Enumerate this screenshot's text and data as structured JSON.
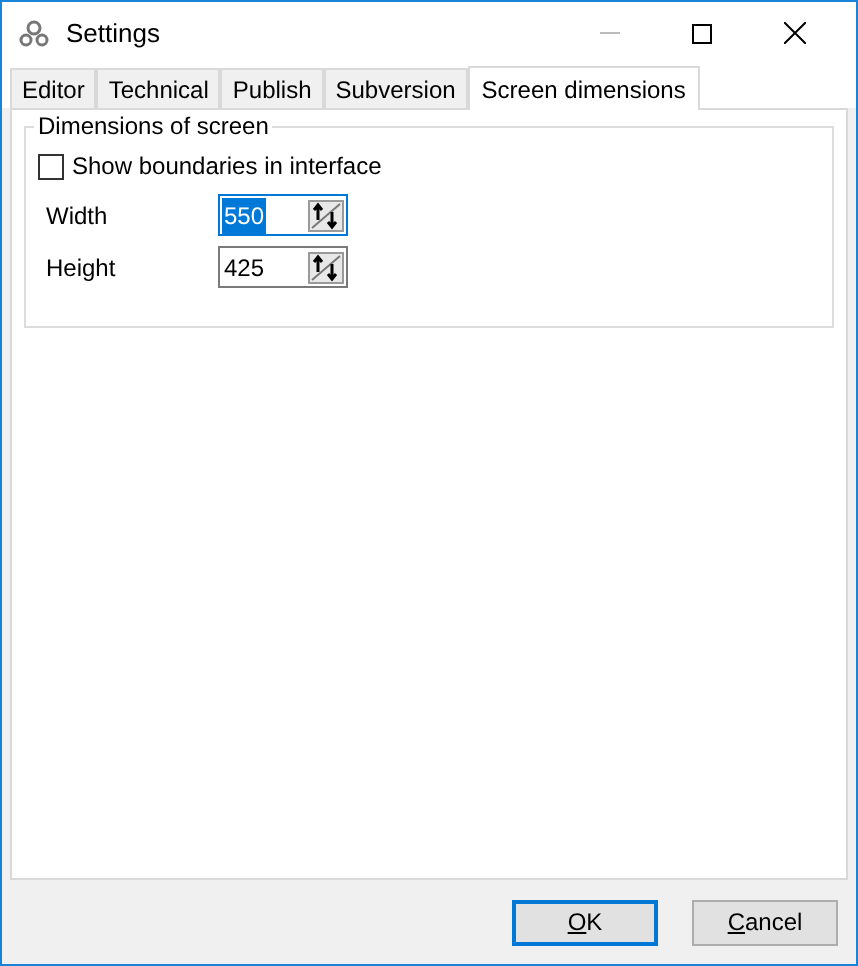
{
  "window": {
    "title": "Settings"
  },
  "tabs": [
    {
      "label": "Editor",
      "selected": false
    },
    {
      "label": "Technical",
      "selected": false
    },
    {
      "label": "Publish",
      "selected": false
    },
    {
      "label": "Subversion",
      "selected": false
    },
    {
      "label": "Screen dimensions",
      "selected": true
    }
  ],
  "group": {
    "title": "Dimensions of screen",
    "checkbox": {
      "label": "Show boundaries in interface",
      "checked": false
    },
    "fields": [
      {
        "label": "Width",
        "value": "550",
        "focused": true
      },
      {
        "label": "Height",
        "value": "425",
        "focused": false
      }
    ]
  },
  "buttons": [
    {
      "label": "OK",
      "default": true
    },
    {
      "label": "Cancel",
      "default": false
    }
  ]
}
